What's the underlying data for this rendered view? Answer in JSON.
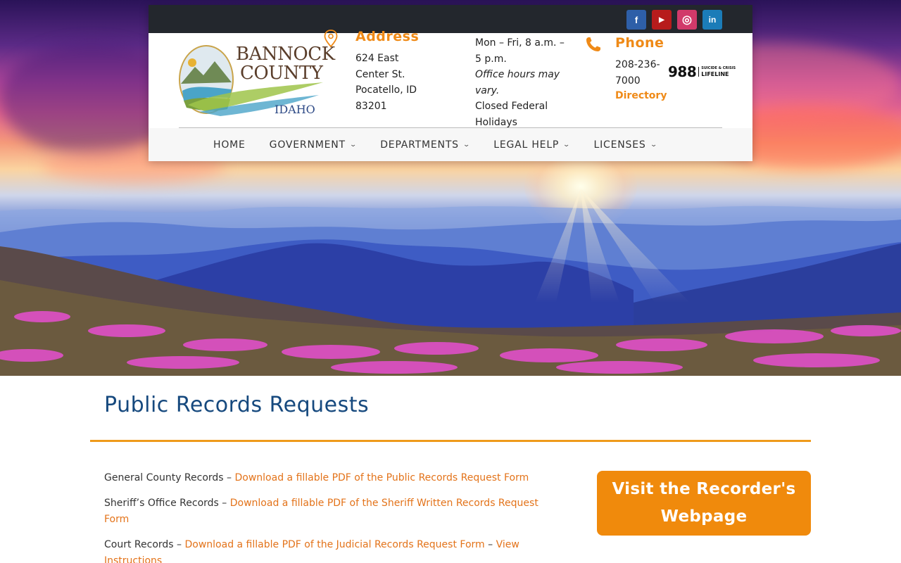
{
  "social": [
    {
      "name": "facebook",
      "glyph": "f"
    },
    {
      "name": "youtube",
      "glyph": "▶"
    },
    {
      "name": "instagram",
      "glyph": "◎"
    },
    {
      "name": "linkedin",
      "glyph": "in"
    }
  ],
  "logo": {
    "line1": "BANNOCK",
    "line2": "COUNTY",
    "line3": "IDAHO"
  },
  "address": {
    "title": "Address",
    "lines": [
      "624 East",
      "Center St.",
      "Pocatello, ID",
      "83201"
    ]
  },
  "hours": {
    "line1": "Mon – Fri, 8 a.m. –",
    "line2": "5 p.m.",
    "note1": "Office hours may",
    "note2": "vary.",
    "closed1": "Closed Federal",
    "closed2": "Holidays"
  },
  "phone": {
    "title": "Phone",
    "number1": "208-236-",
    "number2": "7000",
    "directory": "Directory"
  },
  "lifeline": {
    "number": "988",
    "small1": "SUICIDE & CRISIS",
    "small2": "LIFELINE"
  },
  "nav": {
    "items": [
      {
        "label": "HOME",
        "has_dropdown": false
      },
      {
        "label": "GOVERNMENT",
        "has_dropdown": true
      },
      {
        "label": "DEPARTMENTS",
        "has_dropdown": true
      },
      {
        "label": "LEGAL HELP",
        "has_dropdown": true
      },
      {
        "label": "LICENSES",
        "has_dropdown": true
      }
    ]
  },
  "page": {
    "title": "Public Records Requests"
  },
  "records": [
    {
      "prefix": "General County Records – ",
      "link": "Download a fillable PDF of the Public Records Request Form"
    },
    {
      "prefix": "Sheriff’s Office Records – ",
      "link": "Download a fillable PDF of the Sheriff Written Records Request Form"
    },
    {
      "prefix": "Court Records – ",
      "link": "Download a fillable PDF of the Judicial Records Request Form",
      "sep": " – ",
      "link2": "View Instructions"
    }
  ],
  "recorder_button": {
    "line1": "Visit the Recorder's",
    "line2": "Webpage"
  },
  "colors": {
    "accent": "#ef8a17",
    "title_blue": "#16497e",
    "topbar": "#23272d",
    "button": "#f08a0c"
  }
}
